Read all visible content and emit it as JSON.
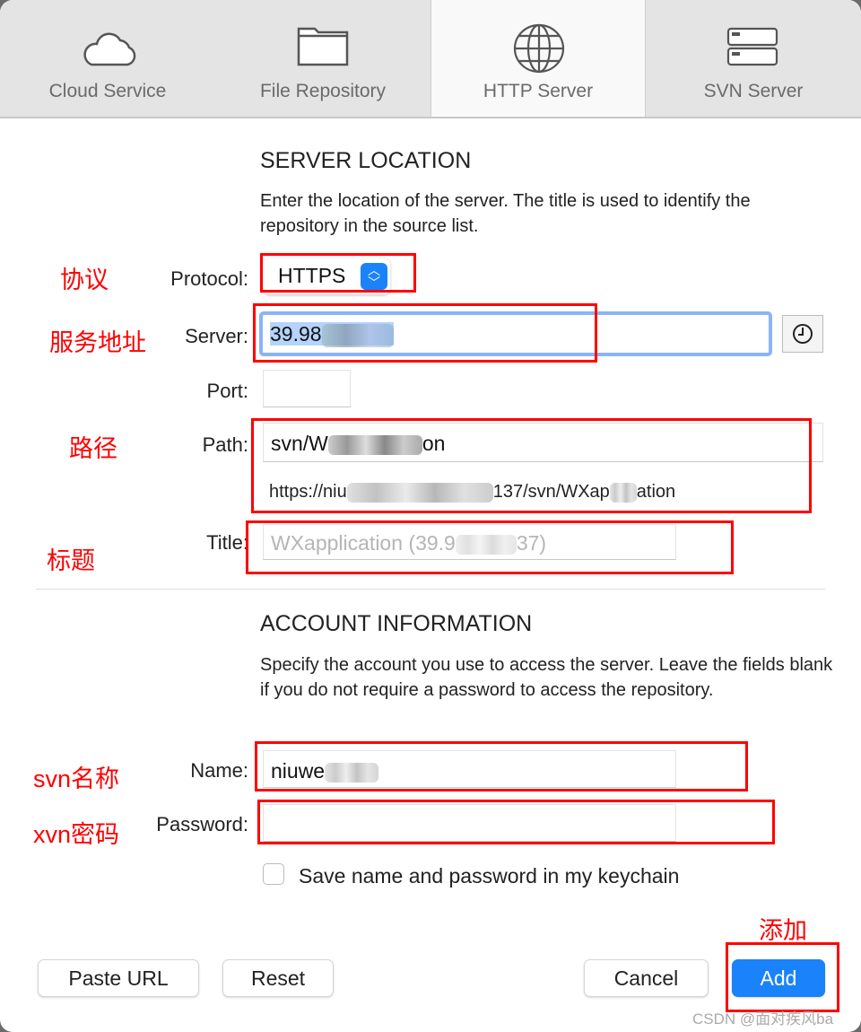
{
  "tabs": [
    {
      "label": "Cloud Service",
      "icon": "cloud-icon"
    },
    {
      "label": "File Repository",
      "icon": "folder-icon"
    },
    {
      "label": "HTTP Server",
      "icon": "globe-icon",
      "active": true
    },
    {
      "label": "SVN Server",
      "icon": "server-icon"
    }
  ],
  "server_location": {
    "heading": "SERVER LOCATION",
    "description": "Enter the location of the server. The title is used to identify the repository in the source list.",
    "protocol_label": "Protocol:",
    "protocol_value": "HTTPS",
    "server_label": "Server:",
    "server_value": "39.98",
    "port_label": "Port:",
    "port_value": "",
    "path_label": "Path:",
    "path_value_start": "svn/W",
    "path_value_end": "on",
    "url_preview_start": "https://niu",
    "url_preview_mid": "137/svn/WXap",
    "url_preview_end": "ation",
    "title_label": "Title:",
    "title_placeholder_start": "WXapplication (39.9",
    "title_placeholder_end": "37)"
  },
  "account": {
    "heading": "ACCOUNT INFORMATION",
    "description": "Specify the account you use to access the server. Leave the fields blank if you do not require a password to access the repository.",
    "name_label": "Name:",
    "name_value": "niuwe",
    "password_label": "Password:",
    "password_value": "",
    "keychain_label": "Save name and password in my keychain",
    "keychain_checked": false
  },
  "buttons": {
    "paste_url": "Paste URL",
    "reset": "Reset",
    "cancel": "Cancel",
    "add": "Add"
  },
  "annotations": {
    "protocol": "协议",
    "server": "服务地址",
    "path": "路径",
    "title": "标题",
    "name": "svn名称",
    "password": "xvn密码",
    "add": "添加"
  },
  "watermark": "CSDN @面对疾风ba",
  "colors": {
    "accent": "#1a82fb",
    "annotation": "#ff0000",
    "focus_ring": "#8ab4f8"
  }
}
